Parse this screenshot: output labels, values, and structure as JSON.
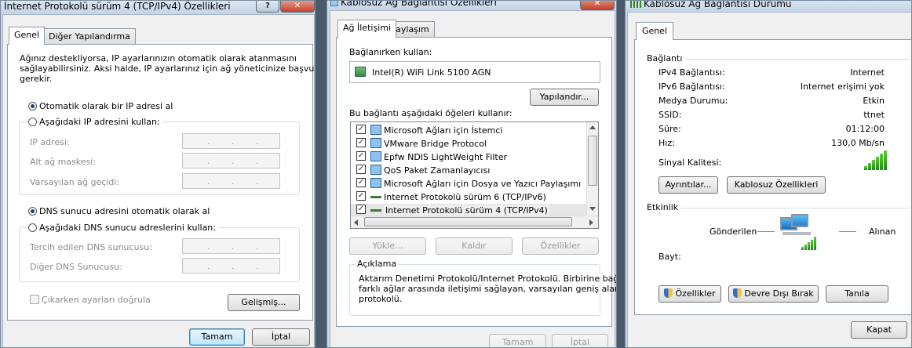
{
  "left": {
    "title": "İnternet Protokolü sürüm 4 (TCP/IPv4) Özellikleri",
    "help_label": "?",
    "close_label": "✕",
    "tabs": [
      "Genel",
      "Diğer Yapılandırma"
    ],
    "description": [
      "Ağınız destekliyorsa, IP ayarlarınızın otomatik olarak atanmasını",
      "sağlayabilirsiniz. Aksi halde, IP ayarlarınız için ağ yöneticinize başvurmanız",
      "gerekir."
    ],
    "ip_auto": "Otomatik olarak bir IP adresi al",
    "ip_manual": "Aşağıdaki IP adresini kullan:",
    "ip_fields": [
      "IP adresi:",
      "Alt ağ maskesi:",
      "Varsayılan ağ geçidi:"
    ],
    "dns_auto": "DNS sunucu adresini otomatik olarak al",
    "dns_manual": "Aşağıdaki DNS sunucu adreslerini kullan:",
    "dns_fields": [
      "Tercih edilen DNS sunucusu:",
      "Diğer DNS Sunucusu:"
    ],
    "validate": "Çıkarken ayarları doğrula",
    "advanced": "Gelişmiş...",
    "ok": "Tamam",
    "cancel": "İptal"
  },
  "middle": {
    "title": "Kablosuz Ağ Bağlantısı Özellikleri",
    "close_label": "✕",
    "tabs": [
      "Ağ İletişimi",
      "Paylaşım"
    ],
    "connect_using": "Bağlanırken kullan:",
    "adapter": "Intel(R) WiFi Link 5100 AGN",
    "configure": "Yapılandır...",
    "items_label": "Bu bağlantı aşağıdaki öğeleri kullanır:",
    "items": [
      "Microsoft Ağları için İstemci",
      "VMware Bridge Protocol",
      "Epfw NDIS LightWeight Filter",
      "QoS Paket Zamanlayıcısı",
      "Microsoft Ağları için Dosya ve Yazıcı Paylaşımı",
      "Internet Protokolü sürüm 6 (TCP/IPv6)",
      "Internet Protokolü sürüm 4 (TCP/IPv4)"
    ],
    "install": "Yükle...",
    "uninstall": "Kaldır",
    "properties": "Özellikler",
    "desc_title": "Açıklama",
    "desc_lines": [
      "Aktarım Denetimi Protokolü/Internet Protokolü. Birbirine bağlı",
      "farklı ağlar arasında iletişimi sağlayan, varsayılan geniş alan ağı",
      "protokolü."
    ],
    "ok": "Tamam",
    "cancel": "İptal"
  },
  "right": {
    "title": "Kablosuz Ağ Bağlantısı Durumu",
    "tab": "Genel",
    "connection_header": "Bağlantı",
    "rows": [
      {
        "label": "IPv4 Bağlantısı:",
        "value": "Internet"
      },
      {
        "label": "IPv6 Bağlantısı:",
        "value": "Internet erişimi yok"
      },
      {
        "label": "Medya Durumu:",
        "value": "Etkin"
      },
      {
        "label": "SSID:",
        "value": "ttnet"
      },
      {
        "label": "Süre:",
        "value": "01:12:00"
      },
      {
        "label": "Hız:",
        "value": "130,0 Mb/sn"
      }
    ],
    "signal_quality": "Sinyal Kalitesi:",
    "details": "Ayrıntılar...",
    "wireless_props": "Kablosuz Özellikleri",
    "activity_header": "Etkinlik",
    "sent": "Gönderilen",
    "received": "Alınan",
    "bytes": "Bayt:",
    "properties": "Özellikler",
    "disable": "Devre Dışı Bırak",
    "diagnose": "Tanıla",
    "close": "Kapat"
  }
}
